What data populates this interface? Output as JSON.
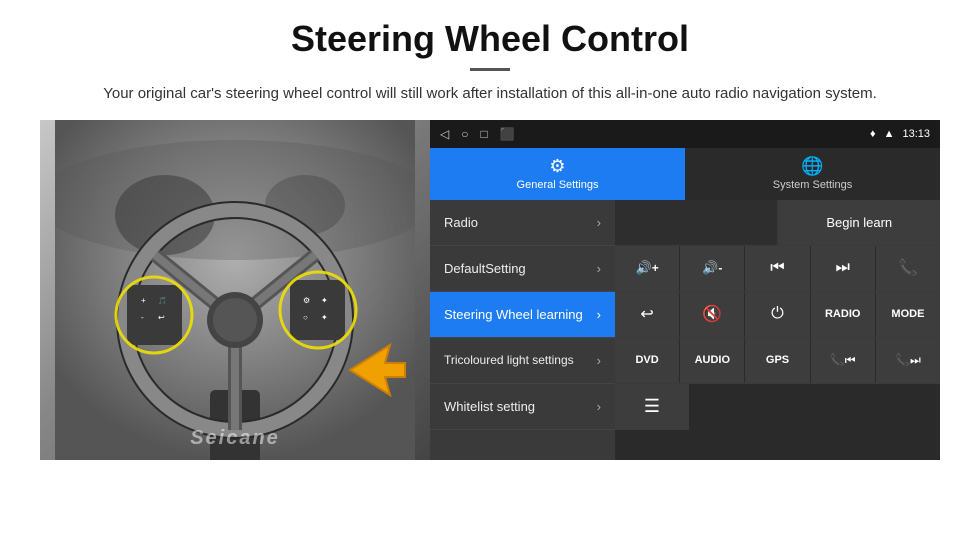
{
  "page": {
    "title": "Steering Wheel Control",
    "subtitle": "Your original car's steering wheel control will still work after installation of this all-in-one auto radio navigation system."
  },
  "statusBar": {
    "time": "13:13",
    "icons": [
      "◁",
      "○",
      "□",
      "⬛"
    ]
  },
  "tabs": [
    {
      "id": "general",
      "label": "General Settings",
      "icon": "⚙",
      "active": true
    },
    {
      "id": "system",
      "label": "System Settings",
      "icon": "🌐",
      "active": false
    }
  ],
  "menuItems": [
    {
      "id": "radio",
      "label": "Radio",
      "active": false
    },
    {
      "id": "default",
      "label": "DefaultSetting",
      "active": false
    },
    {
      "id": "steering",
      "label": "Steering Wheel learning",
      "active": true
    },
    {
      "id": "tricoloured",
      "label": "Tricoloured light settings",
      "active": false
    },
    {
      "id": "whitelist",
      "label": "Whitelist setting",
      "active": false
    }
  ],
  "controls": {
    "beginLearnLabel": "Begin learn",
    "row2": [
      {
        "icon": "🔊+",
        "label": ""
      },
      {
        "icon": "🔊-",
        "label": ""
      },
      {
        "icon": "⏮",
        "label": ""
      },
      {
        "icon": "⏭",
        "label": ""
      },
      {
        "icon": "📞",
        "label": ""
      }
    ],
    "row3": [
      {
        "icon": "↩",
        "label": ""
      },
      {
        "icon": "🔇",
        "label": ""
      },
      {
        "icon": "⏻",
        "label": ""
      },
      {
        "icon": "RADIO",
        "label": "RADIO"
      },
      {
        "icon": "MODE",
        "label": "MODE"
      }
    ],
    "row4": [
      {
        "icon": "DVD",
        "label": "DVD"
      },
      {
        "icon": "AUDIO",
        "label": "AUDIO"
      },
      {
        "icon": "GPS",
        "label": "GPS"
      },
      {
        "icon": "📞⏮",
        "label": ""
      },
      {
        "icon": "📞⏭",
        "label": ""
      }
    ],
    "row5": [
      {
        "icon": "≡",
        "label": ""
      }
    ]
  },
  "watermark": "Seicane"
}
